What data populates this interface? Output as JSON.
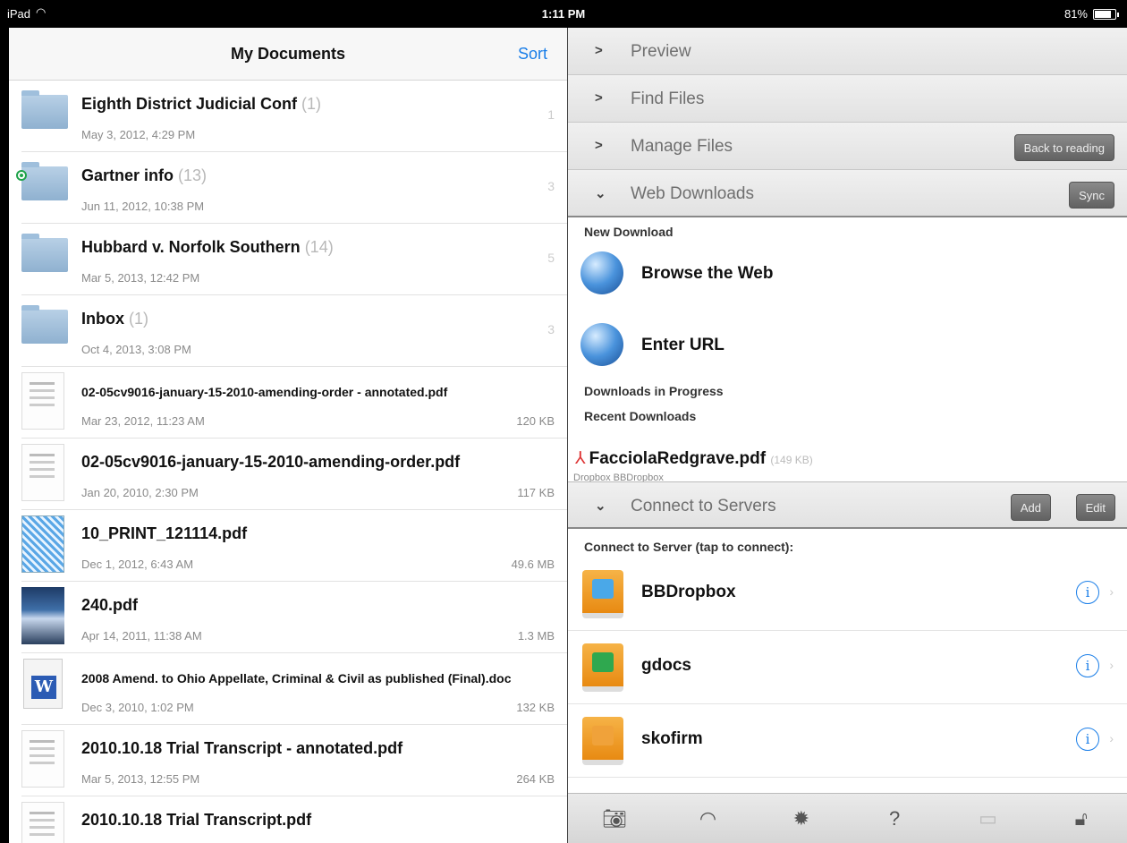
{
  "status": {
    "carrier": "iPad",
    "wifi_icon": "wifi-icon",
    "time": "1:11 PM",
    "battery": "81%",
    "battery_level": 0.81
  },
  "left": {
    "title": "My Documents",
    "sort_label": "Sort",
    "items": [
      {
        "type": "folder",
        "name": "Eighth District Judicial Conf",
        "count": "(1)",
        "date": "May 3, 2012, 4:29 PM",
        "badge": "1"
      },
      {
        "type": "folder",
        "name": "Gartner info",
        "count": "(13)",
        "date": "Jun 11, 2012, 10:38 PM",
        "badge": "3",
        "synced": true
      },
      {
        "type": "folder",
        "name": "Hubbard v. Norfolk Southern",
        "count": "(14)",
        "date": "Mar 5, 2013, 12:42 PM",
        "badge": "5"
      },
      {
        "type": "folder",
        "name": "Inbox",
        "count": "(1)",
        "date": "Oct 4, 2013, 3:08 PM",
        "badge": "3"
      },
      {
        "type": "page",
        "name": "02-05cv9016-january-15-2010-amending-order - annotated.pdf",
        "date": "Mar 23, 2012, 11:23 AM",
        "size": "120 KB",
        "small": true
      },
      {
        "type": "page",
        "name": "02-05cv9016-january-15-2010-amending-order.pdf",
        "date": "Jan 20, 2010, 2:30 PM",
        "size": "117 KB"
      },
      {
        "type": "blue",
        "name": "10_PRINT_121114.pdf",
        "date": "Dec 1, 2012, 6:43 AM",
        "size": "49.6 MB"
      },
      {
        "type": "photo",
        "name": "240.pdf",
        "date": "Apr 14, 2011, 11:38 AM",
        "size": "1.3 MB"
      },
      {
        "type": "word",
        "name": "2008 Amend. to Ohio Appellate, Criminal & Civil as published (Final).doc",
        "date": "Dec 3, 2010, 1:02 PM",
        "size": "132 KB",
        "small": true
      },
      {
        "type": "page",
        "name": "2010.10.18 Trial Transcript - annotated.pdf",
        "date": "Mar 5, 2013, 12:55 PM",
        "size": "264 KB"
      },
      {
        "type": "page",
        "name": "2010.10.18 Trial Transcript.pdf",
        "date": "",
        "size": ""
      }
    ]
  },
  "right": {
    "preview": "Preview",
    "find_files": "Find Files",
    "manage_files": "Manage Files",
    "back_to_reading": "Back to reading",
    "web_downloads": "Web Downloads",
    "sync": "Sync",
    "new_download": "New Download",
    "browse_web": "Browse the Web",
    "enter_url": "Enter URL",
    "downloads_in_progress": "Downloads in Progress",
    "recent_downloads": "Recent Downloads",
    "recent_file": "FacciolaRedgrave.pdf",
    "recent_file_size": "(149 KB)",
    "recent_file_sub": "Dropbox BBDropbox",
    "connect_to_servers": "Connect to Servers",
    "add": "Add",
    "edit": "Edit",
    "connect_hdr": "Connect to Server (tap to connect):",
    "servers": [
      {
        "name": "BBDropbox",
        "logo_color": "#4aa8e8"
      },
      {
        "name": "gdocs",
        "logo_color": "#2fa84f"
      },
      {
        "name": "skofirm",
        "logo_color": "#f0a23a"
      }
    ],
    "toolbar_icons": [
      "camera-icon",
      "wifi-icon",
      "gear-icon",
      "help-icon",
      "monitor-icon",
      "lock-icon"
    ]
  }
}
